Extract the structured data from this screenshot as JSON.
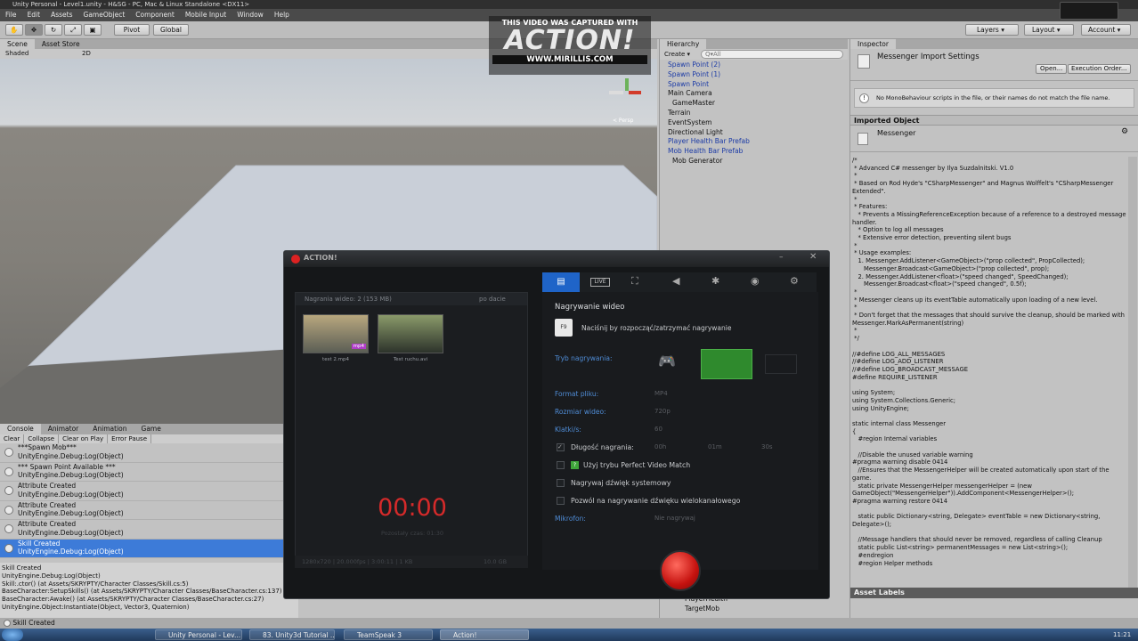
{
  "window_title": "Unity Personal - Level1.unity - H&SG - PC, Mac & Linux Standalone <DX11>",
  "menu": [
    "File",
    "Edit",
    "Assets",
    "GameObject",
    "Component",
    "Mobile Input",
    "Window",
    "Help"
  ],
  "toolbar": {
    "pivot": "Pivot",
    "global": "Global",
    "layers": "Layers",
    "layout": "Layout",
    "account": "Account"
  },
  "scene": {
    "tabs": [
      "Scene",
      "Asset Store"
    ],
    "shading": "Shaded",
    "mode_2d": "2D",
    "persp": "< Persp"
  },
  "watermark": {
    "line1": "THIS VIDEO WAS CAPTURED WITH",
    "logo": "ACTION!",
    "url": "WWW.MIRILLIS.COM"
  },
  "hierarchy": {
    "tab": "Hierarchy",
    "create": "Create",
    "search_placeholder": "Q▾All",
    "items": [
      "Spawn Point (2)",
      "Spawn Point (1)",
      "Spawn Point",
      "Main Camera",
      "GameMaster",
      "Terrain",
      "EventSystem",
      "Directional Light",
      "Player Health Bar Prefab",
      "Mob Health Bar Prefab",
      "Mob Generator"
    ],
    "bottom_items": [
      "PlayerHealth",
      "TargetMob"
    ]
  },
  "inspector": {
    "tab": "Inspector",
    "title": "Messenger Import Settings",
    "open": "Open...",
    "exec_order": "Execution Order...",
    "warning": "No MonoBehaviour scripts in the file, or their names do not match the file name.",
    "imported_object": "Imported Object",
    "object_name": "Messenger",
    "asset_labels": "Asset Labels",
    "code": "/*\n * Advanced C# messenger by Ilya Suzdalnitski. V1.0\n *\n * Based on Rod Hyde's \"CSharpMessenger\" and Magnus Wolffelt's \"CSharpMessenger Extended\".\n *\n * Features:\n \t* Prevents a MissingReferenceException because of a reference to a destroyed message handler.\n \t* Option to log all messages\n \t* Extensive error detection, preventing silent bugs\n *\n * Usage examples:\n \t1. Messenger.AddListener<GameObject>(\"prop collected\", PropCollected);\n \t   Messenger.Broadcast<GameObject>(\"prop collected\", prop);\n \t2. Messenger.AddListener<float>(\"speed changed\", SpeedChanged);\n \t   Messenger.Broadcast<float>(\"speed changed\", 0.5f);\n *\n * Messenger cleans up its eventTable automatically upon loading of a new level.\n *\n * Don't forget that the messages that should survive the cleanup, should be marked with Messenger.MarkAsPermanent(string)\n *\n */\n\n//#define LOG_ALL_MESSAGES\n//#define LOG_ADD_LISTENER\n//#define LOG_BROADCAST_MESSAGE\n#define REQUIRE_LISTENER\n\nusing System;\nusing System.Collections.Generic;\nusing UnityEngine;\n\nstatic internal class Messenger\n{\n\t#region Internal variables\n\n\t//Disable the unused variable warning\n#pragma warning disable 0414\n\t//Ensures that the MessengerHelper will be created automatically upon start of the game.\n\tstatic private MessengerHelper messengerHelper = (new GameObject(\"MessengerHelper\")).AddComponent<MessengerHelper>();\n#pragma warning restore 0414\n\n\tstatic public Dictionary<string, Delegate> eventTable = new Dictionary<string, Delegate>();\n\n\t//Message handlers that should never be removed, regardless of calling Cleanup\n\tstatic public List<string> permanentMessages = new List<string>();\n\t#endregion\n\t#region Helper methods"
  },
  "console": {
    "tabs": [
      "Console",
      "Animator",
      "Animation",
      "Game"
    ],
    "buttons": [
      "Clear",
      "Collapse",
      "Clear on Play",
      "Error Pause"
    ],
    "rows": [
      {
        "l1": "***Spawn Mob***",
        "l2": "UnityEngine.Debug:Log(Object)"
      },
      {
        "l1": "*** Spawn Point Available ***",
        "l2": "UnityEngine.Debug:Log(Object)"
      },
      {
        "l1": "Attribute Created",
        "l2": "UnityEngine.Debug:Log(Object)"
      },
      {
        "l1": "Attribute Created",
        "l2": "UnityEngine.Debug:Log(Object)"
      },
      {
        "l1": "Attribute Created",
        "l2": "UnityEngine.Debug:Log(Object)"
      },
      {
        "l1": "Skill Created",
        "l2": "UnityEngine.Debug:Log(Object)"
      }
    ],
    "detail": [
      "Skill Created",
      "UnityEngine.Debug:Log(Object)",
      "Skill:.ctor() (at Assets/SKRYPTY/Character Classes/Skill.cs:5)",
      "BaseCharacter:SetupSkills() (at Assets/SKRYPTY/Character Classes/BaseCharacter.cs:137)",
      "BaseCharacter:Awake() (at Assets/SKRYPTY/Character Classes/BaseCharacter.cs:27)",
      "UnityEngine.Object:Instantiate(Object, Vector3, Quaternion)"
    ],
    "status": "Skill Created"
  },
  "action": {
    "title": "ACTION!",
    "list_header": "Nagrania wideo: 2 (153 MB)",
    "sort": "po dacie",
    "thumbs": [
      {
        "name": "test 2.mp4",
        "badge": "mp4"
      },
      {
        "name": "Test ruchu.avi",
        "badge": ""
      }
    ],
    "timer": "00:00",
    "remaining": "Pozostały czas: 01:30",
    "info_left": "1280x720 | 20.000fps | 3:00:11 | 1 KB",
    "info_right": "10.0 GB",
    "tabs": [
      "video",
      "LIVE",
      "game",
      "audio",
      "spider",
      "camera",
      "settings"
    ],
    "section": "Nagrywanie wideo",
    "hint": "Naciśnij by rozpocząć/zatrzymać nagrywanie",
    "hint_key": "F9",
    "fields": [
      {
        "label": "Tryb nagrywania:",
        "value": ""
      },
      {
        "label": "Format pliku:",
        "value": "MP4"
      },
      {
        "label": "Rozmiar wideo:",
        "value": "720p"
      },
      {
        "label": "Klatki/s:",
        "value": "60"
      }
    ],
    "duration_label": "Długość nagrania:",
    "duration": [
      "00h",
      "01m",
      "30s"
    ],
    "opts": [
      "Użyj trybu Perfect Video Match",
      "Nagrywaj dźwięk systemowy",
      "Pozwól na nagrywanie dźwięku wielokanałowego"
    ],
    "mic_label": "Mikrofon:",
    "mic_value": "Nie nagrywaj"
  },
  "taskbar": {
    "tasks": [
      "Unity Personal - Lev...",
      "83. Unity3d Tutorial ...",
      "TeamSpeak 3",
      "Action!"
    ],
    "clock": "11:21"
  }
}
